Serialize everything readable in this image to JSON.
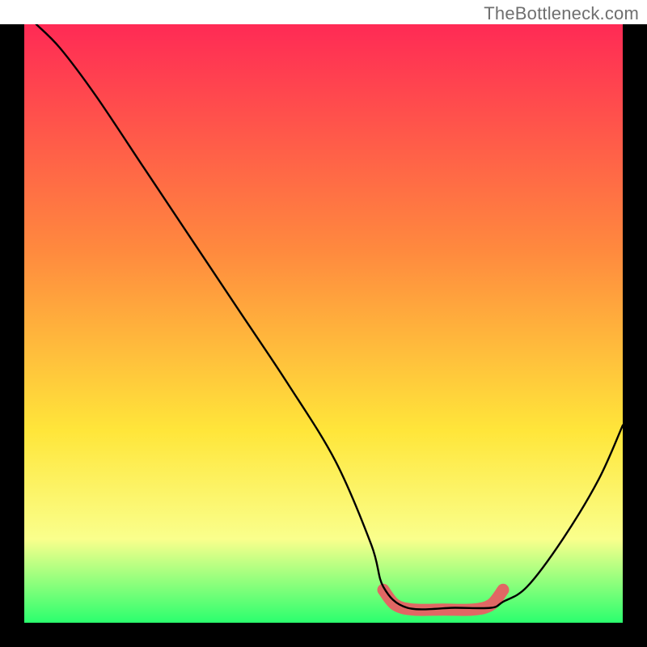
{
  "watermark": "TheBottleneck.com",
  "colors": {
    "gradient_top": "#ff2a55",
    "gradient_mid1": "#ff8a3e",
    "gradient_mid2": "#ffe63a",
    "gradient_mid3": "#faff8c",
    "gradient_bottom": "#2bff6e",
    "curve": "#000000",
    "highlight": "#e16764",
    "frame": "#000000"
  },
  "chart_data": {
    "type": "line",
    "title": "",
    "xlabel": "",
    "ylabel": "",
    "xlim": [
      0,
      100
    ],
    "ylim": [
      0,
      100
    ],
    "series": [
      {
        "name": "bottleneck-curve",
        "x": [
          2,
          6,
          12,
          20,
          28,
          36,
          44,
          52,
          58,
          60,
          64,
          72,
          78,
          80,
          84,
          90,
          96,
          100
        ],
        "y": [
          100,
          96,
          88,
          76,
          64,
          52,
          40,
          27,
          13,
          6,
          2.5,
          2.5,
          2.5,
          3.5,
          6,
          14,
          24,
          33
        ]
      },
      {
        "name": "ideal-zone-highlight",
        "x": [
          60,
          62,
          65,
          70,
          75,
          78,
          80
        ],
        "y": [
          5.5,
          3.0,
          2.2,
          2.2,
          2.2,
          3.0,
          5.5
        ]
      }
    ]
  }
}
